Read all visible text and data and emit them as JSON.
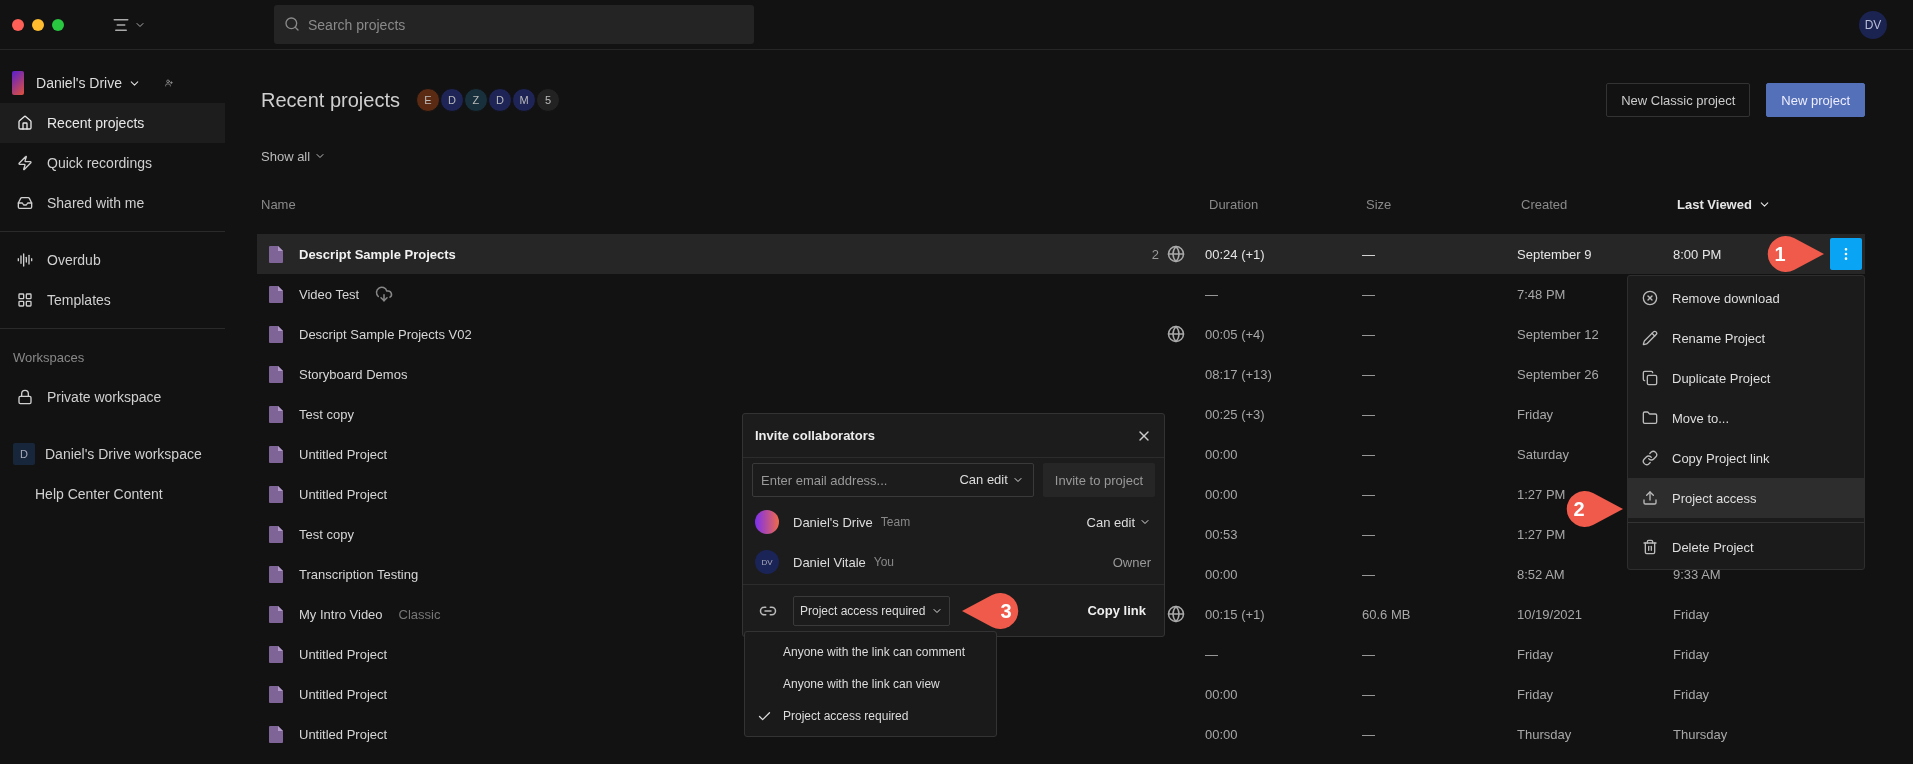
{
  "search": {
    "placeholder": "Search projects"
  },
  "user": {
    "initials": "DV"
  },
  "sidebar": {
    "drive": {
      "name": "Daniel's Drive"
    },
    "nav": [
      {
        "label": "Recent projects",
        "selected": true
      },
      {
        "label": "Quick recordings",
        "selected": false
      },
      {
        "label": "Shared with me",
        "selected": false
      }
    ],
    "tools": [
      {
        "label": "Overdub",
        "selected": false
      },
      {
        "label": "Templates",
        "selected": false
      }
    ],
    "workspaces_heading": "Workspaces",
    "workspaces": [
      {
        "label": "Private workspace",
        "kind": "locked"
      },
      {
        "label": "Daniel's Drive workspace",
        "kind": "team",
        "badge": "D"
      },
      {
        "label": "Help Center Content",
        "kind": "plain"
      }
    ]
  },
  "page": {
    "title": "Recent projects",
    "collaborators": [
      {
        "initial": "E",
        "color": "#5b2a12"
      },
      {
        "initial": "D",
        "color": "#1e2456"
      },
      {
        "initial": "Z",
        "color": "#17303c"
      },
      {
        "initial": "D",
        "color": "#1e2456"
      },
      {
        "initial": "M",
        "color": "#1e2456"
      },
      {
        "initial": "5",
        "color": "#222222"
      }
    ],
    "buttons": [
      {
        "label": "New Classic project",
        "kind": "secondary"
      },
      {
        "label": "New project",
        "kind": "primary"
      }
    ],
    "filter": "Show all"
  },
  "table": {
    "columns": [
      {
        "label": "Name",
        "sorted": false
      },
      {
        "label": "Duration",
        "sorted": false
      },
      {
        "label": "Size",
        "sorted": false
      },
      {
        "label": "Created",
        "sorted": false
      },
      {
        "label": "Last Viewed",
        "sorted": true
      }
    ],
    "rows": [
      {
        "name": "Descript Sample Projects",
        "shared_count": "2",
        "public": true,
        "offline": false,
        "selected": true,
        "duration": "00:24 (+1)",
        "size": "—",
        "created": "September 9",
        "last_viewed": "8:00 PM"
      },
      {
        "name": "Video Test",
        "public": false,
        "offline": true,
        "selected": false,
        "duration": "—",
        "size": "—",
        "created": "7:48 PM"
      },
      {
        "name": "Descript Sample Projects V02",
        "public": true,
        "offline": false,
        "selected": false,
        "duration": "00:05 (+4)",
        "size": "—",
        "created": "September 12"
      },
      {
        "name": "Storyboard Demos",
        "public": false,
        "offline": false,
        "selected": false,
        "duration": "08:17 (+13)",
        "size": "—",
        "created": "September 26"
      },
      {
        "name": "Test copy",
        "public": false,
        "offline": false,
        "selected": false,
        "duration": "00:25 (+3)",
        "size": "—",
        "created": "Friday"
      },
      {
        "name": "Untitled Project",
        "public": false,
        "offline": false,
        "selected": false,
        "duration": "00:00",
        "size": "—",
        "created": "Saturday"
      },
      {
        "name": "Untitled Project",
        "public": false,
        "offline": false,
        "selected": false,
        "duration": "00:00",
        "size": "—",
        "created": "1:27 PM"
      },
      {
        "name": "Test copy",
        "public": false,
        "offline": false,
        "selected": false,
        "duration": "00:53",
        "size": "—",
        "created": "1:27 PM"
      },
      {
        "name": "Transcription Testing",
        "public": false,
        "offline": false,
        "selected": false,
        "duration": "00:00",
        "size": "—",
        "created": "8:52 AM",
        "last_viewed": "9:33 AM"
      },
      {
        "name": "My Intro Video",
        "tag": "Classic",
        "public": true,
        "offline": false,
        "selected": false,
        "duration": "00:15 (+1)",
        "size": "60.6 MB",
        "created": "10/19/2021",
        "last_viewed": "Friday"
      },
      {
        "name": "Untitled Project",
        "public": false,
        "offline": false,
        "selected": false,
        "duration": "—",
        "size": "—",
        "created": "Friday",
        "last_viewed": "Friday"
      },
      {
        "name": "Untitled Project",
        "public": false,
        "offline": false,
        "selected": false,
        "duration": "00:00",
        "size": "—",
        "created": "Friday",
        "last_viewed": "Friday"
      },
      {
        "name": "Untitled Project",
        "public": false,
        "offline": false,
        "selected": false,
        "duration": "00:00",
        "size": "—",
        "created": "Thursday",
        "last_viewed": "Thursday"
      }
    ]
  },
  "context_menu": {
    "groups": [
      [
        {
          "label": "Remove download",
          "selected": false
        },
        {
          "label": "Rename Project",
          "selected": false
        },
        {
          "label": "Duplicate Project",
          "selected": false
        },
        {
          "label": "Move to...",
          "selected": false
        },
        {
          "label": "Copy Project link",
          "selected": false
        },
        {
          "label": "Project access",
          "selected": true
        }
      ],
      [
        {
          "label": "Delete Project",
          "selected": false
        }
      ]
    ]
  },
  "dialog": {
    "title": "Invite collaborators",
    "email_placeholder": "Enter email address...",
    "role": "Can edit",
    "invite_button": "Invite to project",
    "members": [
      {
        "name": "Daniel's Drive",
        "tag": "Team",
        "role": "Can edit",
        "kind": "team"
      },
      {
        "name": "Daniel Vitale",
        "tag": "You",
        "role": "Owner",
        "kind": "person",
        "initials": "DV"
      }
    ],
    "access": "Project access required",
    "copy_link": "Copy link",
    "access_options": [
      {
        "label": "Anyone with the link can comment",
        "selected": false
      },
      {
        "label": "Anyone with the link can view",
        "selected": false
      },
      {
        "label": "Project access required",
        "selected": true
      }
    ]
  },
  "callouts": [
    {
      "label": "1"
    },
    {
      "label": "2"
    },
    {
      "label": "3"
    }
  ]
}
